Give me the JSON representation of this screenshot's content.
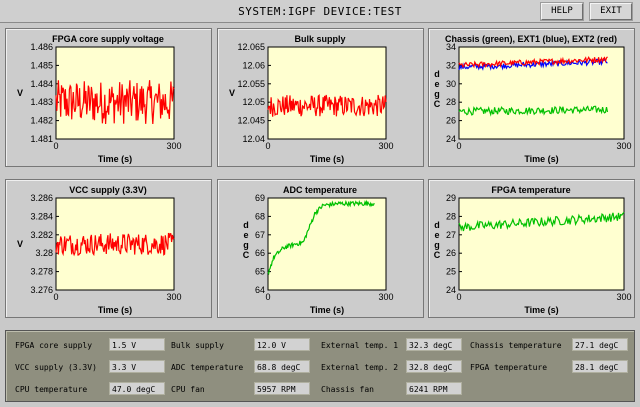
{
  "window": {
    "title": "SYSTEM:IGPF DEVICE:TEST",
    "help_label": "HELP",
    "exit_label": "EXIT"
  },
  "colors": {
    "plot_bg": "#ffffd0",
    "trace_red": "#ff0000",
    "trace_green": "#00c000",
    "trace_blue": "#0000ff"
  },
  "charts": [
    {
      "id": "fpga-core",
      "title": "FPGA core supply voltage",
      "xlabel": "Time (s)",
      "ylabel": "V",
      "yticks": [
        "1.486",
        "1.485",
        "1.484",
        "1.483",
        "1.482",
        "1.481"
      ],
      "xticks": [
        "0",
        "300"
      ]
    },
    {
      "id": "bulk",
      "title": "Bulk supply",
      "xlabel": "Time (s)",
      "ylabel": "V",
      "yticks": [
        "12.065",
        "12.06",
        "12.055",
        "12.05",
        "12.045",
        "12.04"
      ],
      "xticks": [
        "0",
        "300"
      ]
    },
    {
      "id": "chassis-ext",
      "title": "Chassis (green), EXT1 (blue), EXT2 (red)",
      "xlabel": "Time (s)",
      "ylabel": "deg C",
      "yticks": [
        "34",
        "32",
        "30",
        "28",
        "26",
        "24"
      ],
      "xticks": [
        "0",
        "300"
      ]
    },
    {
      "id": "vcc",
      "title": "VCC supply (3.3V)",
      "xlabel": "Time (s)",
      "ylabel": "V",
      "yticks": [
        "3.286",
        "3.284",
        "3.282",
        "3.28",
        "3.278",
        "3.276"
      ],
      "xticks": [
        "0",
        "300"
      ]
    },
    {
      "id": "adc-temp",
      "title": "ADC temperature",
      "xlabel": "Time (s)",
      "ylabel": "deg C",
      "yticks": [
        "69",
        "68",
        "67",
        "66",
        "65",
        "64"
      ],
      "xticks": [
        "0",
        "300"
      ]
    },
    {
      "id": "fpga-temp",
      "title": "FPGA temperature",
      "xlabel": "Time (s)",
      "ylabel": "deg C",
      "yticks": [
        "29",
        "28",
        "27",
        "26",
        "25",
        "24"
      ],
      "xticks": [
        "0",
        "300"
      ]
    }
  ],
  "chart_data": [
    {
      "type": "line",
      "title": "FPGA core supply voltage",
      "xlabel": "Time (s)",
      "ylabel": "V",
      "xlim": [
        0,
        300
      ],
      "ylim": [
        1.481,
        1.486
      ],
      "series": [
        {
          "color": "#ff0000",
          "x": [
            0,
            300
          ],
          "mean": 1.483,
          "spread": 0.0012
        }
      ]
    },
    {
      "type": "line",
      "title": "Bulk supply",
      "xlabel": "Time (s)",
      "ylabel": "V",
      "xlim": [
        0,
        300
      ],
      "ylim": [
        12.04,
        12.065
      ],
      "series": [
        {
          "color": "#ff0000",
          "x": [
            0,
            300
          ],
          "mean": 12.049,
          "spread": 0.003
        }
      ]
    },
    {
      "type": "line",
      "title": "Chassis (green), EXT1 (blue), EXT2 (red)",
      "xlabel": "Time (s)",
      "ylabel": "deg C",
      "xlim": [
        0,
        300
      ],
      "ylim": [
        24,
        34
      ],
      "series": [
        {
          "name": "Chassis",
          "color": "#00c000",
          "x": [
            0,
            270
          ],
          "start": 27.0,
          "end": 27.2,
          "spread": 0.4
        },
        {
          "name": "EXT1",
          "color": "#0000ff",
          "x": [
            0,
            270
          ],
          "start": 31.8,
          "end": 32.4,
          "spread": 0.3
        },
        {
          "name": "EXT2",
          "color": "#ff0000",
          "x": [
            0,
            270
          ],
          "start": 32.0,
          "end": 32.7,
          "spread": 0.3
        }
      ]
    },
    {
      "type": "line",
      "title": "VCC supply (3.3V)",
      "xlabel": "Time (s)",
      "ylabel": "V",
      "xlim": [
        0,
        300
      ],
      "ylim": [
        3.276,
        3.286
      ],
      "series": [
        {
          "color": "#ff0000",
          "x": [
            0,
            300
          ],
          "mean": 3.281,
          "spread": 0.0012
        }
      ]
    },
    {
      "type": "line",
      "title": "ADC temperature",
      "xlabel": "Time (s)",
      "ylabel": "deg C",
      "xlim": [
        0,
        300
      ],
      "ylim": [
        64,
        69
      ],
      "series": [
        {
          "color": "#00c000",
          "x": [
            0,
            270
          ],
          "points": [
            [
              0,
              64.9
            ],
            [
              15,
              65.8
            ],
            [
              40,
              66.3
            ],
            [
              70,
              66.5
            ],
            [
              90,
              66.6
            ],
            [
              105,
              67.4
            ],
            [
              120,
              68.2
            ],
            [
              140,
              68.6
            ],
            [
              180,
              68.7
            ],
            [
              220,
              68.7
            ],
            [
              270,
              68.7
            ]
          ],
          "spread": 0.12
        }
      ]
    },
    {
      "type": "line",
      "title": "FPGA temperature",
      "xlabel": "Time (s)",
      "ylabel": "deg C",
      "xlim": [
        0,
        300
      ],
      "ylim": [
        24,
        29
      ],
      "series": [
        {
          "color": "#00c000",
          "x": [
            0,
            300
          ],
          "start": 27.4,
          "end": 28.0,
          "spread": 0.25
        }
      ]
    }
  ],
  "status": {
    "fpga_core_supply": {
      "label": "FPGA core supply",
      "value": "1.5 V"
    },
    "vcc_supply": {
      "label": "VCC supply (3.3V)",
      "value": "3.3 V"
    },
    "cpu_temperature": {
      "label": "CPU temperature",
      "value": "47.0 degC"
    },
    "bulk_supply": {
      "label": "Bulk supply",
      "value": "12.0 V"
    },
    "adc_temperature": {
      "label": "ADC temperature",
      "value": "68.8 degC"
    },
    "cpu_fan": {
      "label": "CPU fan",
      "value": "5957 RPM"
    },
    "external_temp_1": {
      "label": "External temp. 1",
      "value": "32.3 degC"
    },
    "external_temp_2": {
      "label": "External temp. 2",
      "value": "32.8 degC"
    },
    "chassis_fan": {
      "label": "Chassis fan",
      "value": "6241 RPM"
    },
    "chassis_temperature": {
      "label": "Chassis temperature",
      "value": "27.1 degC"
    },
    "fpga_temperature": {
      "label": "FPGA temperature",
      "value": "28.1 degC"
    }
  }
}
